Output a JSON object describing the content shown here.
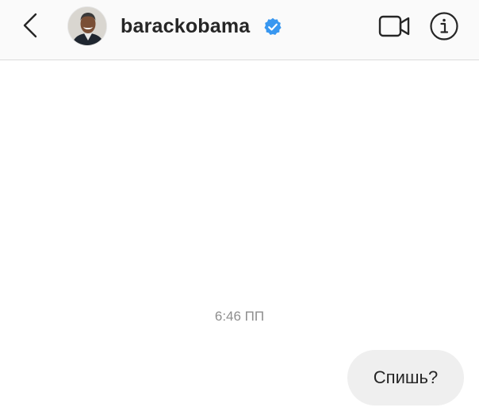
{
  "header": {
    "username": "barackobama",
    "verified": true,
    "icons": {
      "back": "chevron-left-icon",
      "verified": "verified-badge-icon",
      "video": "video-camera-icon",
      "info": "info-icon"
    },
    "colors": {
      "verified_badge": "#3897f0",
      "text": "#262626",
      "header_bg": "#fafafa"
    }
  },
  "thread": {
    "timestamp": "6:46 ПП",
    "messages": [
      {
        "from": "me",
        "text": "Спишь?"
      }
    ]
  }
}
